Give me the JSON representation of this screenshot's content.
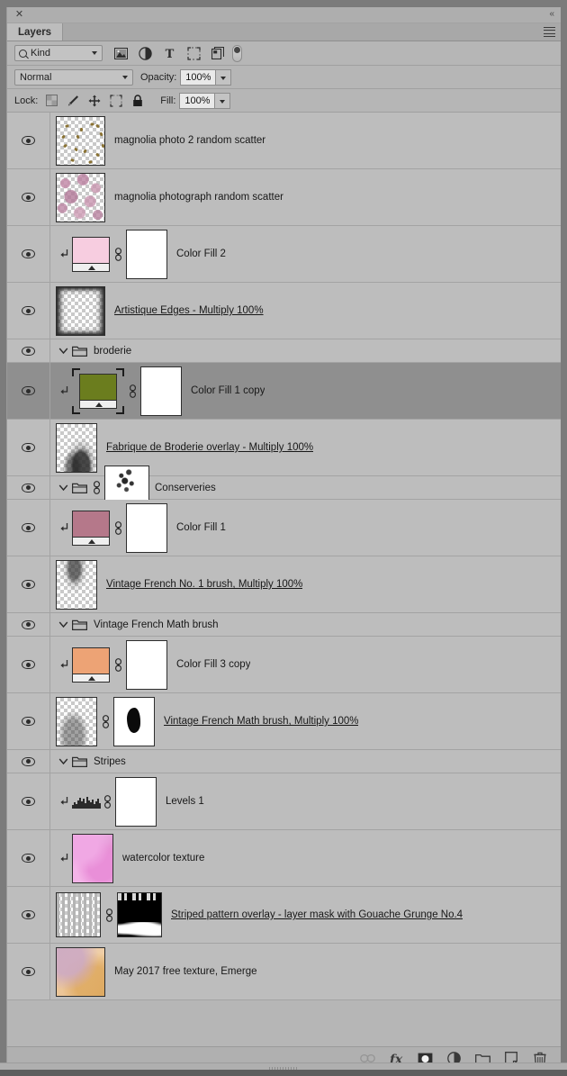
{
  "panel": {
    "tab_label": "Layers",
    "close_icon": "close-icon",
    "collapse_icon": "collapse-panel-icon",
    "menu_icon": "panel-menu-icon"
  },
  "filter_bar": {
    "kind_label": "Kind",
    "search_icon": "search-icon",
    "icons": [
      {
        "name": "filter-pixel-layers-icon"
      },
      {
        "name": "filter-adjustment-layers-icon"
      },
      {
        "name": "filter-type-layers-icon"
      },
      {
        "name": "filter-shape-layers-icon"
      },
      {
        "name": "filter-smart-object-layers-icon"
      }
    ],
    "toggle_name": "filter-enable-toggle"
  },
  "blend_bar": {
    "blend_mode": "Normal",
    "opacity_label": "Opacity:",
    "opacity_value": "100%"
  },
  "lock_bar": {
    "lock_label": "Lock:",
    "fill_label": "Fill:",
    "fill_value": "100%",
    "icons": [
      {
        "name": "lock-transparent-pixels-icon"
      },
      {
        "name": "lock-image-pixels-icon"
      },
      {
        "name": "lock-position-icon"
      },
      {
        "name": "lock-artboard-nesting-icon"
      },
      {
        "name": "lock-all-icon"
      }
    ]
  },
  "layers": [
    {
      "name": "magnolia photo 2 random scatter",
      "type": "pixel",
      "underline": false,
      "selected": false,
      "visible": true,
      "indent": 0,
      "thumb": "scatter-gold",
      "clipped": false,
      "linked": false
    },
    {
      "name": "magnolia photograph random scatter",
      "type": "pixel",
      "underline": false,
      "selected": false,
      "visible": true,
      "indent": 0,
      "thumb": "magnolia-pink",
      "clipped": false,
      "linked": false
    },
    {
      "name": "Color Fill 2",
      "type": "fill",
      "underline": false,
      "selected": false,
      "visible": true,
      "indent": 0,
      "fill_color": "#f7cde0",
      "clipped": true,
      "linked": true,
      "mask": "white"
    },
    {
      "name": "Artistique Edges - Multiply 100%",
      "type": "pixel",
      "underline": true,
      "selected": false,
      "visible": true,
      "indent": 0,
      "thumb": "artistique-edges",
      "clipped": false,
      "linked": false
    },
    {
      "name": "broderie",
      "type": "group",
      "underline": false,
      "selected": false,
      "visible": true,
      "indent": 0,
      "expanded": true
    },
    {
      "name": "Color Fill 1 copy",
      "type": "fill",
      "underline": false,
      "selected": true,
      "visible": true,
      "indent": 0,
      "fill_color": "#6b7d1e",
      "clipped": true,
      "linked": true,
      "mask": "white"
    },
    {
      "name": "Fabrique de Broderie overlay - Multiply 100%",
      "type": "pixel",
      "underline": true,
      "selected": false,
      "visible": true,
      "indent": 0,
      "thumb": "broderie-overlay",
      "clipped": false,
      "linked": false
    },
    {
      "name": "Conserveries",
      "type": "group",
      "underline": false,
      "selected": false,
      "visible": true,
      "indent": 0,
      "expanded": true,
      "linked": true,
      "mask": "conserveries-mask"
    },
    {
      "name": "Color Fill 1",
      "type": "fill",
      "underline": false,
      "selected": false,
      "visible": true,
      "indent": 0,
      "fill_color": "#b5788a",
      "clipped": true,
      "linked": true,
      "mask": "white"
    },
    {
      "name": "Vintage French No. 1 brush, Multiply 100%",
      "type": "pixel",
      "underline": true,
      "selected": false,
      "visible": true,
      "indent": 0,
      "thumb": "vintage-french-brush",
      "clipped": false,
      "linked": false
    },
    {
      "name": "Vintage French Math brush",
      "type": "group",
      "underline": false,
      "selected": false,
      "visible": true,
      "indent": 0,
      "expanded": true
    },
    {
      "name": "Color Fill 3 copy",
      "type": "fill",
      "underline": false,
      "selected": false,
      "visible": true,
      "indent": 0,
      "fill_color": "#eda375",
      "clipped": true,
      "linked": true,
      "mask": "white"
    },
    {
      "name": "Vintage French Math brush, Multiply 100%",
      "type": "pixel",
      "underline": true,
      "selected": false,
      "visible": true,
      "indent": 0,
      "thumb": "math-brush",
      "clipped": false,
      "linked": true,
      "mask": "black-blob"
    },
    {
      "name": "Stripes",
      "type": "group",
      "underline": false,
      "selected": false,
      "visible": true,
      "indent": 0,
      "expanded": true
    },
    {
      "name": "Levels 1",
      "type": "adjustment",
      "underline": false,
      "selected": false,
      "visible": true,
      "indent": 0,
      "clipped": true,
      "linked": true,
      "mask": "white",
      "adjustment_icon": "levels-histogram-icon"
    },
    {
      "name": "watercolor texture",
      "type": "pixel",
      "underline": false,
      "selected": false,
      "visible": true,
      "indent": 0,
      "thumb": "watercolor",
      "clipped": true,
      "linked": false
    },
    {
      "name": "Striped pattern overlay - layer mask with Gouache Grunge No.4",
      "type": "pixel",
      "underline": true,
      "selected": false,
      "visible": true,
      "indent": 0,
      "thumb": "stripes-pattern",
      "clipped": false,
      "linked": true,
      "mask": "gouache-grunge"
    },
    {
      "name": "May 2017 free texture, Emerge",
      "type": "pixel",
      "underline": false,
      "selected": false,
      "visible": true,
      "indent": 0,
      "thumb": "emerge-texture",
      "clipped": false,
      "linked": false
    }
  ],
  "bottom_toolbar": [
    {
      "name": "link-layers-button",
      "glyph": "link",
      "disabled": true
    },
    {
      "name": "layer-style-fx-button",
      "glyph": "fx",
      "disabled": false
    },
    {
      "name": "add-layer-mask-button",
      "glyph": "mask",
      "disabled": false
    },
    {
      "name": "new-adjustment-layer-button",
      "glyph": "adjustment",
      "disabled": false
    },
    {
      "name": "new-group-button",
      "glyph": "folder",
      "disabled": false
    },
    {
      "name": "new-layer-button",
      "glyph": "newlayer",
      "disabled": false
    },
    {
      "name": "delete-layer-button",
      "glyph": "trash",
      "disabled": false
    }
  ],
  "colors": {
    "panel_bg": "#b6b6b6",
    "row_bg": "#bdbdbd",
    "row_selected_bg": "#8f8f8f",
    "text": "#181818"
  }
}
